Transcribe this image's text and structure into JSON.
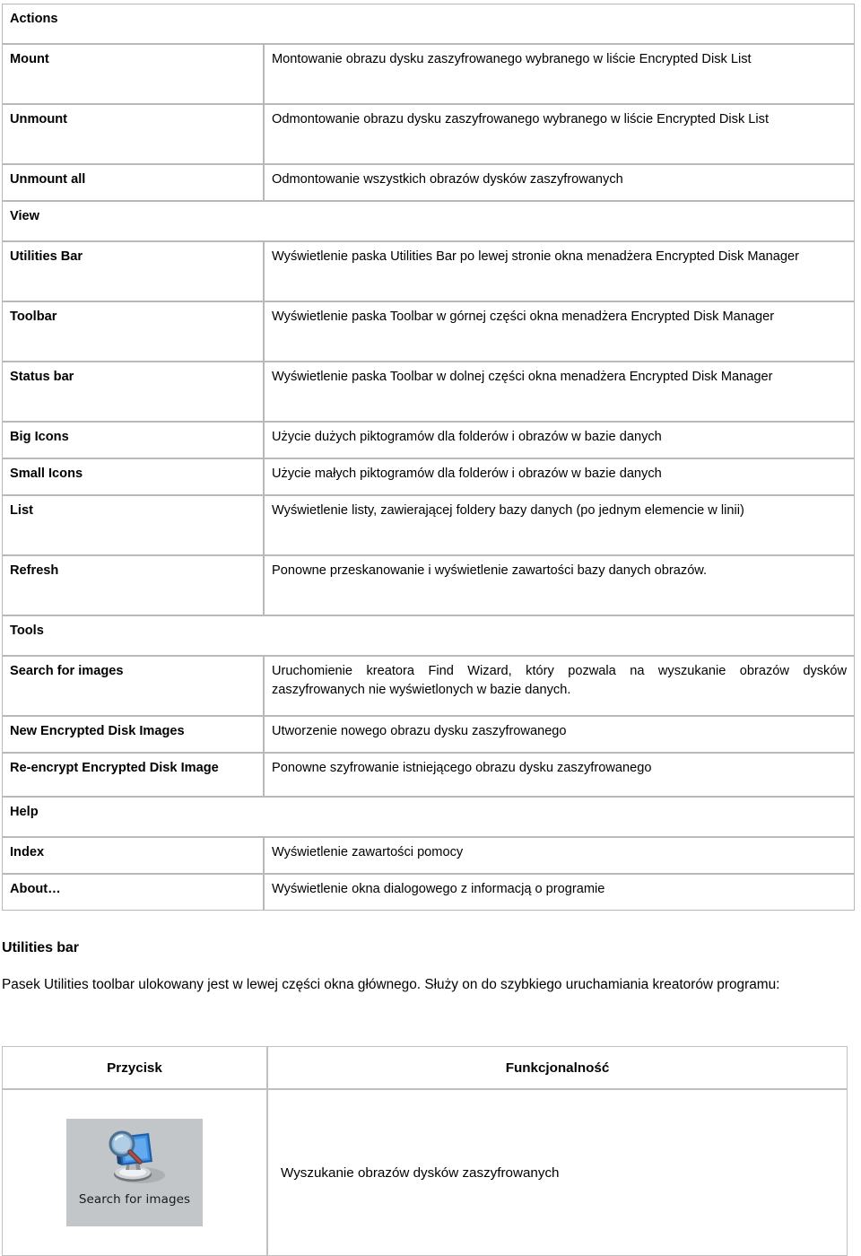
{
  "menu_table": {
    "rows": [
      {
        "type": "section",
        "label": "Actions"
      },
      {
        "type": "item",
        "key": "Mount",
        "desc": "Montowanie obrazu dysku zaszyfrowanego wybranego w liście Encrypted Disk List",
        "height": "tall"
      },
      {
        "type": "item",
        "key": "Unmount",
        "desc": "Odmontowanie obrazu dysku zaszyfrowanego wybranego w liście Encrypted Disk List",
        "height": "tall"
      },
      {
        "type": "item",
        "key": "Unmount all",
        "desc": "Odmontowanie wszystkich obrazów dysków zaszyfrowanych",
        "height": "one"
      },
      {
        "type": "section",
        "label": "View"
      },
      {
        "type": "item",
        "key": "Utilities Bar",
        "desc": "Wyświetlenie paska Utilities Bar po lewej stronie okna menadżera Encrypted Disk Manager",
        "height": "tall"
      },
      {
        "type": "item",
        "key": "Toolbar",
        "desc": "Wyświetlenie paska Toolbar w górnej części okna menadżera Encrypted Disk Manager",
        "height": "tall"
      },
      {
        "type": "item",
        "key": "Status bar",
        "desc": "Wyświetlenie paska Toolbar w dolnej części okna menadżera Encrypted Disk Manager",
        "height": "tall"
      },
      {
        "type": "item",
        "key": "Big Icons",
        "desc": "Użycie dużych piktogramów dla folderów i obrazów w bazie danych",
        "height": "one"
      },
      {
        "type": "item",
        "key": "Small Icons",
        "desc": "Użycie małych piktogramów dla folderów i obrazów w bazie danych",
        "height": "one"
      },
      {
        "type": "item",
        "key": "List",
        "desc": "Wyświetlenie listy, zawierającej foldery bazy danych (po jednym elemencie w linii)",
        "height": "tall"
      },
      {
        "type": "item",
        "key": "Refresh",
        "desc": "Ponowne przeskanowanie i wyświetlenie zawartości bazy danych obrazów.",
        "height": "tall"
      },
      {
        "type": "section",
        "label": "Tools"
      },
      {
        "type": "item",
        "key": "Search for images",
        "desc": "Uruchomienie kreatora Find Wizard, który pozwala na wyszukanie obrazów dysków zaszyfrowanych nie wyświetlonych w bazie danych.",
        "height": "tall"
      },
      {
        "type": "item",
        "key": "New Encrypted Disk Images",
        "desc": "Utworzenie nowego obrazu dysku zaszyfrowanego",
        "height": "one"
      },
      {
        "type": "item",
        "key": "Re-encrypt Encrypted Disk Image",
        "desc": "Ponowne szyfrowanie istniejącego obrazu dysku zaszyfrowanego",
        "height": "med"
      },
      {
        "type": "section",
        "label": "Help"
      },
      {
        "type": "item",
        "key": "Index",
        "desc": "Wyświetlenie zawartości pomocy",
        "height": "one"
      },
      {
        "type": "item",
        "key": "About…",
        "desc": "Wyświetlenie okna dialogowego z informacją o programie",
        "height": "one"
      }
    ]
  },
  "utilities_section": {
    "heading": "Utilities bar",
    "paragraph": "Pasek Utilities toolbar ulokowany jest w lewej części okna głównego. Służy on do szybkiego uruchamiania kreatorów programu:"
  },
  "button_table": {
    "headers": [
      "Przycisk",
      "Funkcjonalność"
    ],
    "rows": [
      {
        "button_label": "Search for images",
        "button_icon": "monitor-magnifier-icon",
        "description": "Wyszukanie obrazów dysków zaszyfrowanych"
      }
    ]
  },
  "colors": {
    "table_border": "#b9b9b9",
    "button_face": "#c3c6c9",
    "icon_blue": "#2f7fd0",
    "text": "#000000"
  }
}
